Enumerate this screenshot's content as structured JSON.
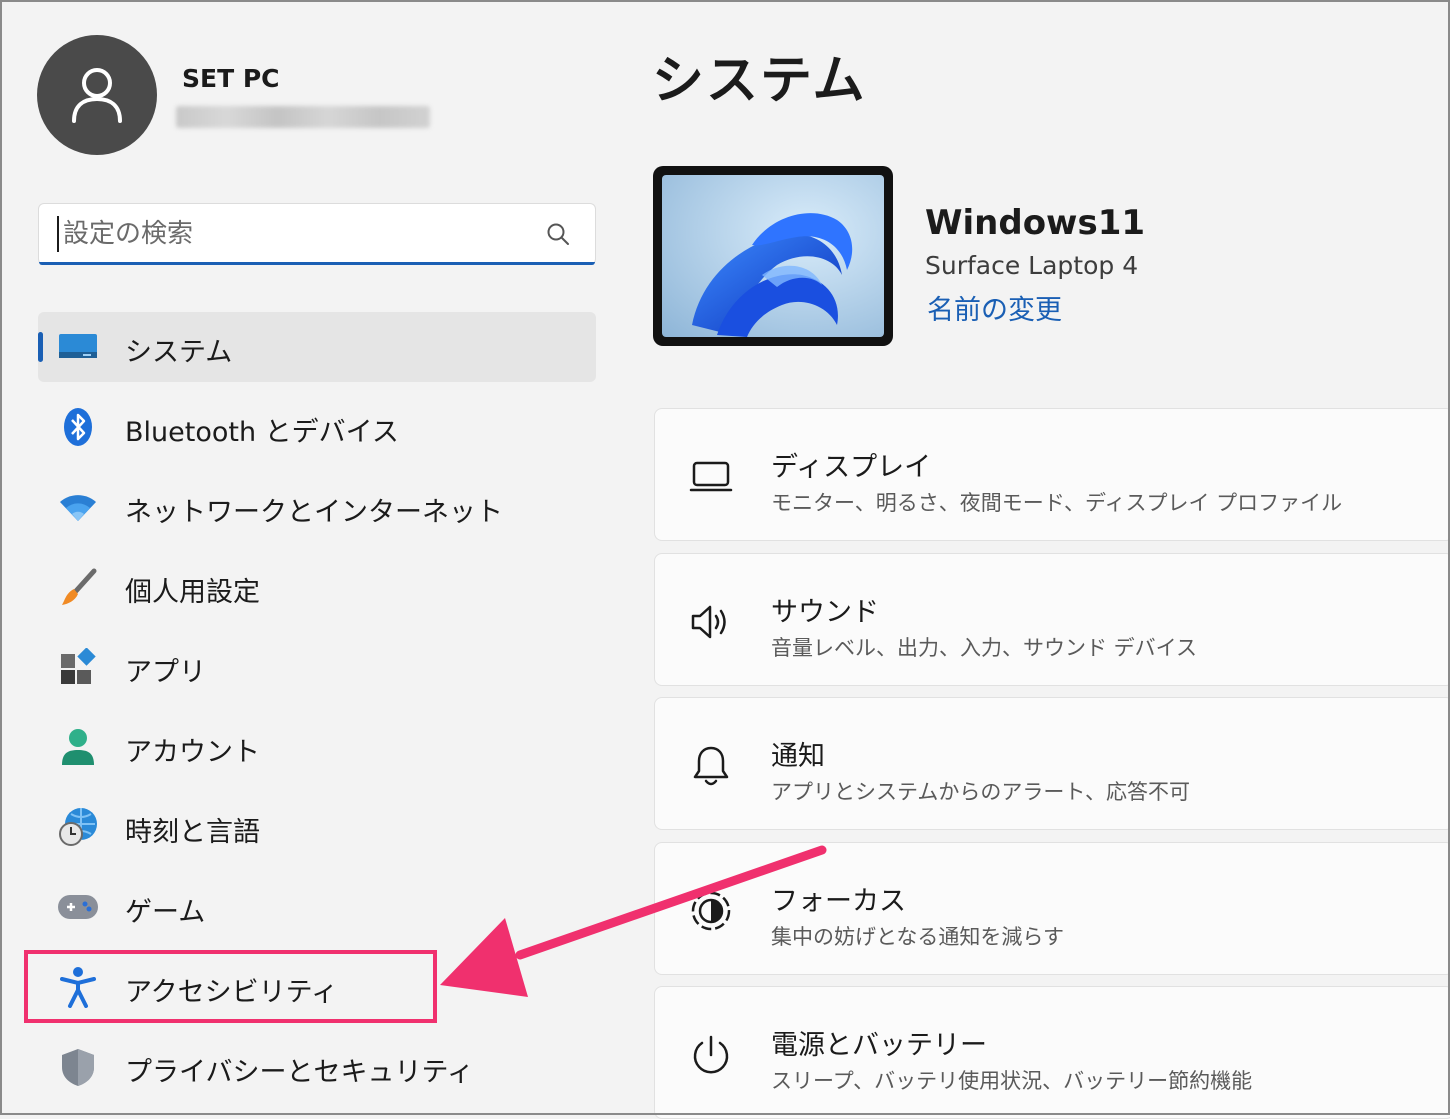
{
  "account": {
    "name": "SET PC"
  },
  "search": {
    "placeholder": "設定の検索"
  },
  "sidebar": {
    "items": [
      {
        "label": "システム",
        "icon": "monitor-icon"
      },
      {
        "label": "Bluetooth とデバイス",
        "icon": "bluetooth-icon"
      },
      {
        "label": "ネットワークとインターネット",
        "icon": "wifi-icon"
      },
      {
        "label": "個人用設定",
        "icon": "brush-icon"
      },
      {
        "label": "アプリ",
        "icon": "apps-icon"
      },
      {
        "label": "アカウント",
        "icon": "person-icon"
      },
      {
        "label": "時刻と言語",
        "icon": "globe-clock-icon"
      },
      {
        "label": "ゲーム",
        "icon": "gamepad-icon"
      },
      {
        "label": "アクセシビリティ",
        "icon": "accessibility-icon"
      },
      {
        "label": "プライバシーとセキュリティ",
        "icon": "shield-icon"
      }
    ],
    "selected_index": 0,
    "highlighted_index": 8
  },
  "main": {
    "title": "システム",
    "device": {
      "name": "Windows11",
      "model": "Surface Laptop 4",
      "rename_label": "名前の変更"
    },
    "cards": [
      {
        "title": "ディスプレイ",
        "subtitle": "モニター、明るさ、夜間モード、ディスプレイ プロファイル",
        "icon": "display-icon"
      },
      {
        "title": "サウンド",
        "subtitle": "音量レベル、出力、入力、サウンド デバイス",
        "icon": "speaker-icon"
      },
      {
        "title": "通知",
        "subtitle": "アプリとシステムからのアラート、応答不可",
        "icon": "bell-icon"
      },
      {
        "title": "フォーカス",
        "subtitle": "集中の妨げとなる通知を減らす",
        "icon": "focus-icon"
      },
      {
        "title": "電源とバッテリー",
        "subtitle": "スリープ、バッテリ使用状況、バッテリー節約機能",
        "icon": "power-icon"
      }
    ]
  },
  "colors": {
    "accent": "#1a5fb4",
    "annotation": "#f0306e",
    "background": "#f3f3f3"
  }
}
